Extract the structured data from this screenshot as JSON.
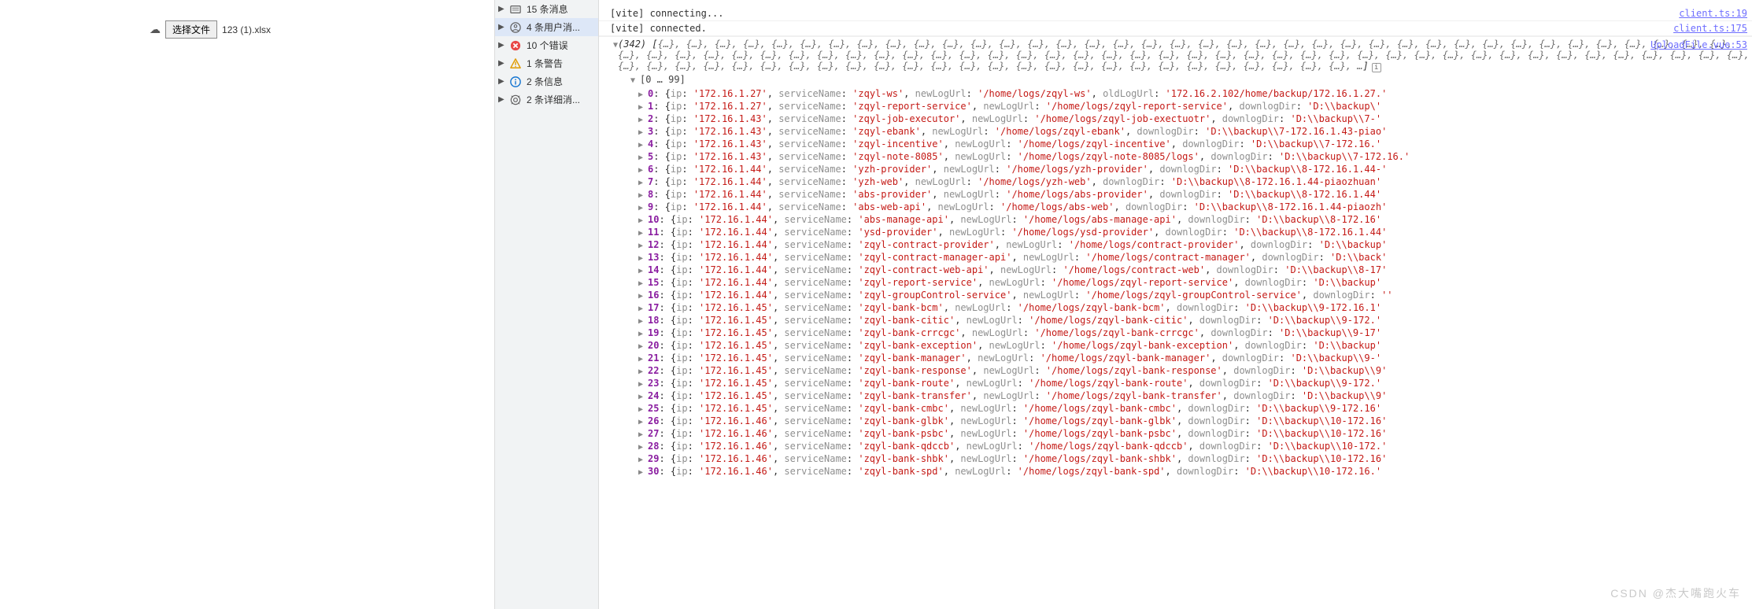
{
  "upload": {
    "button_label": "选择文件",
    "filename": "123 (1).xlsx"
  },
  "filters": [
    {
      "label": "15 条消息",
      "icon": "msg",
      "sel": false
    },
    {
      "label": "4 条用户消...",
      "icon": "user",
      "sel": true
    },
    {
      "label": "10 个错误",
      "icon": "err",
      "sel": false
    },
    {
      "label": "1 条警告",
      "icon": "warn",
      "sel": false
    },
    {
      "label": "2 条信息",
      "icon": "info",
      "sel": false
    },
    {
      "label": "2 条详细消...",
      "icon": "verb",
      "sel": false
    }
  ],
  "console_top": [
    {
      "msg": "[vite] connecting...",
      "src": "client.ts:19"
    },
    {
      "msg": "[vite] connected.",
      "src": "client.ts:175"
    }
  ],
  "array_src": "UploadFile.vue:53",
  "array_count": "(342)",
  "array_range": "[0 … 99]",
  "placeholder": "{…}",
  "placeholder_repeat_row1": 26,
  "placeholder_repeat_row2": 27,
  "placeholder_repeat_row3": 27,
  "placeholder_repeat_row4": 24,
  "chart_data": [
    {
      "idx": 0,
      "ip": "172.16.1.27",
      "serviceName": "zqyl-ws",
      "newLogUrl": "/home/logs/zqyl-ws",
      "oldKey": "oldLogUrl",
      "oldVal": "172.16.2.102/home/backup/172.16.1.27."
    },
    {
      "idx": 1,
      "ip": "172.16.1.27",
      "serviceName": "zqyl-report-service",
      "newLogUrl": "/home/logs/zqyl-report-service",
      "oldKey": "downlogDir",
      "oldVal": "D:\\\\backup\\"
    },
    {
      "idx": 2,
      "ip": "172.16.1.43",
      "serviceName": "zqyl-job-executor",
      "newLogUrl": "/home/logs/zqyl-job-exectuotr",
      "oldKey": "downlogDir",
      "oldVal": "D:\\\\backup\\\\7-"
    },
    {
      "idx": 3,
      "ip": "172.16.1.43",
      "serviceName": "zqyl-ebank",
      "newLogUrl": "/home/logs/zqyl-ebank",
      "oldKey": "downlogDir",
      "oldVal": "D:\\\\backup\\\\7-172.16.1.43-piao"
    },
    {
      "idx": 4,
      "ip": "172.16.1.43",
      "serviceName": "zqyl-incentive",
      "newLogUrl": "/home/logs/zqyl-incentive",
      "oldKey": "downlogDir",
      "oldVal": "D:\\\\backup\\\\7-172.16."
    },
    {
      "idx": 5,
      "ip": "172.16.1.43",
      "serviceName": "zqyl-note-8085",
      "newLogUrl": "/home/logs/zqyl-note-8085/logs",
      "oldKey": "downlogDir",
      "oldVal": "D:\\\\backup\\\\7-172.16."
    },
    {
      "idx": 6,
      "ip": "172.16.1.44",
      "serviceName": "yzh-provider",
      "newLogUrl": "/home/logs/yzh-provider",
      "oldKey": "downlogDir",
      "oldVal": "D:\\\\backup\\\\8-172.16.1.44-"
    },
    {
      "idx": 7,
      "ip": "172.16.1.44",
      "serviceName": "yzh-web",
      "newLogUrl": "/home/logs/yzh-web",
      "oldKey": "downlogDir",
      "oldVal": "D:\\\\backup\\\\8-172.16.1.44-piaozhuan"
    },
    {
      "idx": 8,
      "ip": "172.16.1.44",
      "serviceName": "abs-provider",
      "newLogUrl": "/home/logs/abs-provider",
      "oldKey": "downlogDir",
      "oldVal": "D:\\\\backup\\\\8-172.16.1.44"
    },
    {
      "idx": 9,
      "ip": "172.16.1.44",
      "serviceName": "abs-web-api",
      "newLogUrl": "/home/logs/abs-web",
      "oldKey": "downlogDir",
      "oldVal": "D:\\\\backup\\\\8-172.16.1.44-piaozh"
    },
    {
      "idx": 10,
      "ip": "172.16.1.44",
      "serviceName": "abs-manage-api",
      "newLogUrl": "/home/logs/abs-manage-api",
      "oldKey": "downlogDir",
      "oldVal": "D:\\\\backup\\\\8-172.16"
    },
    {
      "idx": 11,
      "ip": "172.16.1.44",
      "serviceName": "ysd-provider",
      "newLogUrl": "/home/logs/ysd-provider",
      "oldKey": "downlogDir",
      "oldVal": "D:\\\\backup\\\\8-172.16.1.44"
    },
    {
      "idx": 12,
      "ip": "172.16.1.44",
      "serviceName": "zqyl-contract-provider",
      "newLogUrl": "/home/logs/contract-provider",
      "oldKey": "downlogDir",
      "oldVal": "D:\\\\backup"
    },
    {
      "idx": 13,
      "ip": "172.16.1.44",
      "serviceName": "zqyl-contract-manager-api",
      "newLogUrl": "/home/logs/contract-manager",
      "oldKey": "downlogDir",
      "oldVal": "D:\\\\back"
    },
    {
      "idx": 14,
      "ip": "172.16.1.44",
      "serviceName": "zqyl-contract-web-api",
      "newLogUrl": "/home/logs/contract-web",
      "oldKey": "downlogDir",
      "oldVal": "D:\\\\backup\\\\8-17"
    },
    {
      "idx": 15,
      "ip": "172.16.1.44",
      "serviceName": "zqyl-report-service",
      "newLogUrl": "/home/logs/zqyl-report-service",
      "oldKey": "downlogDir",
      "oldVal": "D:\\\\backup"
    },
    {
      "idx": 16,
      "ip": "172.16.1.44",
      "serviceName": "zqyl-groupControl-service",
      "newLogUrl": "/home/logs/zqyl-groupControl-service",
      "oldKey": "downlogDir",
      "oldVal": ""
    },
    {
      "idx": 17,
      "ip": "172.16.1.45",
      "serviceName": "zqyl-bank-bcm",
      "newLogUrl": "/home/logs/zqyl-bank-bcm",
      "oldKey": "downlogDir",
      "oldVal": "D:\\\\backup\\\\9-172.16.1"
    },
    {
      "idx": 18,
      "ip": "172.16.1.45",
      "serviceName": "zqyl-bank-citic",
      "newLogUrl": "/home/logs/zqyl-bank-citic",
      "oldKey": "downlogDir",
      "oldVal": "D:\\\\backup\\\\9-172."
    },
    {
      "idx": 19,
      "ip": "172.16.1.45",
      "serviceName": "zqyl-bank-crrcgc",
      "newLogUrl": "/home/logs/zqyl-bank-crrcgc",
      "oldKey": "downlogDir",
      "oldVal": "D:\\\\backup\\\\9-17"
    },
    {
      "idx": 20,
      "ip": "172.16.1.45",
      "serviceName": "zqyl-bank-exception",
      "newLogUrl": "/home/logs/zqyl-bank-exception",
      "oldKey": "downlogDir",
      "oldVal": "D:\\\\backup"
    },
    {
      "idx": 21,
      "ip": "172.16.1.45",
      "serviceName": "zqyl-bank-manager",
      "newLogUrl": "/home/logs/zqyl-bank-manager",
      "oldKey": "downlogDir",
      "oldVal": "D:\\\\backup\\\\9-"
    },
    {
      "idx": 22,
      "ip": "172.16.1.45",
      "serviceName": "zqyl-bank-response",
      "newLogUrl": "/home/logs/zqyl-bank-response",
      "oldKey": "downlogDir",
      "oldVal": "D:\\\\backup\\\\9"
    },
    {
      "idx": 23,
      "ip": "172.16.1.45",
      "serviceName": "zqyl-bank-route",
      "newLogUrl": "/home/logs/zqyl-bank-route",
      "oldKey": "downlogDir",
      "oldVal": "D:\\\\backup\\\\9-172."
    },
    {
      "idx": 24,
      "ip": "172.16.1.45",
      "serviceName": "zqyl-bank-transfer",
      "newLogUrl": "/home/logs/zqyl-bank-transfer",
      "oldKey": "downlogDir",
      "oldVal": "D:\\\\backup\\\\9"
    },
    {
      "idx": 25,
      "ip": "172.16.1.45",
      "serviceName": "zqyl-bank-cmbc",
      "newLogUrl": "/home/logs/zqyl-bank-cmbc",
      "oldKey": "downlogDir",
      "oldVal": "D:\\\\backup\\\\9-172.16"
    },
    {
      "idx": 26,
      "ip": "172.16.1.46",
      "serviceName": "zqyl-bank-glbk",
      "newLogUrl": "/home/logs/zqyl-bank-glbk",
      "oldKey": "downlogDir",
      "oldVal": "D:\\\\backup\\\\10-172.16"
    },
    {
      "idx": 27,
      "ip": "172.16.1.46",
      "serviceName": "zqyl-bank-psbc",
      "newLogUrl": "/home/logs/zqyl-bank-psbc",
      "oldKey": "downlogDir",
      "oldVal": "D:\\\\backup\\\\10-172.16"
    },
    {
      "idx": 28,
      "ip": "172.16.1.46",
      "serviceName": "zqyl-bank-qdccb",
      "newLogUrl": "/home/logs/zqyl-bank-qdccb",
      "oldKey": "downlogDir",
      "oldVal": "D:\\\\backup\\\\10-172."
    },
    {
      "idx": 29,
      "ip": "172.16.1.46",
      "serviceName": "zqyl-bank-shbk",
      "newLogUrl": "/home/logs/zqyl-bank-shbk",
      "oldKey": "downlogDir",
      "oldVal": "D:\\\\backup\\\\10-172.16"
    },
    {
      "idx": 30,
      "ip": "172.16.1.46",
      "serviceName": "zqyl-bank-spd",
      "newLogUrl": "/home/logs/zqyl-bank-spd",
      "oldKey": "downlogDir",
      "oldVal": "D:\\\\backup\\\\10-172.16."
    }
  ],
  "watermark": "CSDN @杰大嘴跑火车"
}
